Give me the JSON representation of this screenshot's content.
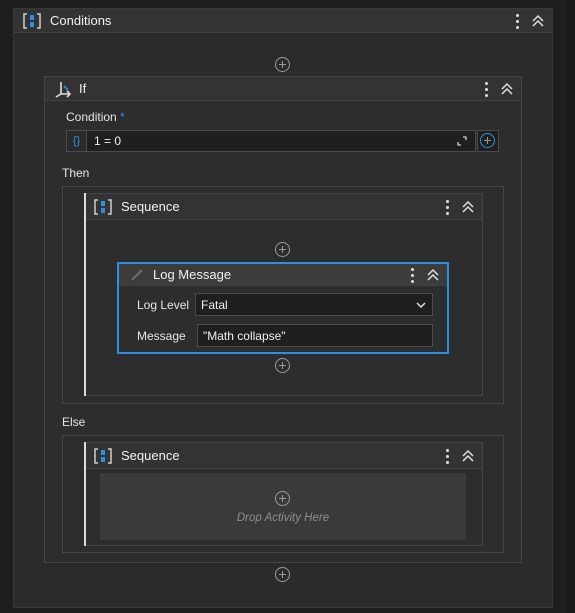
{
  "conditions": {
    "title": "Conditions"
  },
  "if_block": {
    "title": "If",
    "condition_label": "Condition",
    "required_mark": "*",
    "condition_badge": "{}",
    "condition_value": "1 = 0",
    "then_label": "Then",
    "else_label": "Else"
  },
  "then_sequence": {
    "title": "Sequence"
  },
  "log_message": {
    "title": "Log Message",
    "log_level_label": "Log Level",
    "log_level_value": "Fatal",
    "message_label": "Message",
    "message_value": "\"Math collapse\""
  },
  "else_sequence": {
    "title": "Sequence",
    "drop_text": "Drop Activity Here"
  },
  "colors": {
    "accent_blue": "#1e90ff",
    "selection_border": "#2f8ee0",
    "background": "#1e1e1e"
  },
  "icons": {
    "sequence": "sequence-bracket-icon",
    "if": "branch-arrow-icon",
    "log": "pencil-icon",
    "menu": "kebab-icon",
    "collapse": "double-chevron-up-icon",
    "add": "plus-circle-icon",
    "expand": "expand-corner-icon",
    "dropdown": "chevron-down-icon"
  }
}
